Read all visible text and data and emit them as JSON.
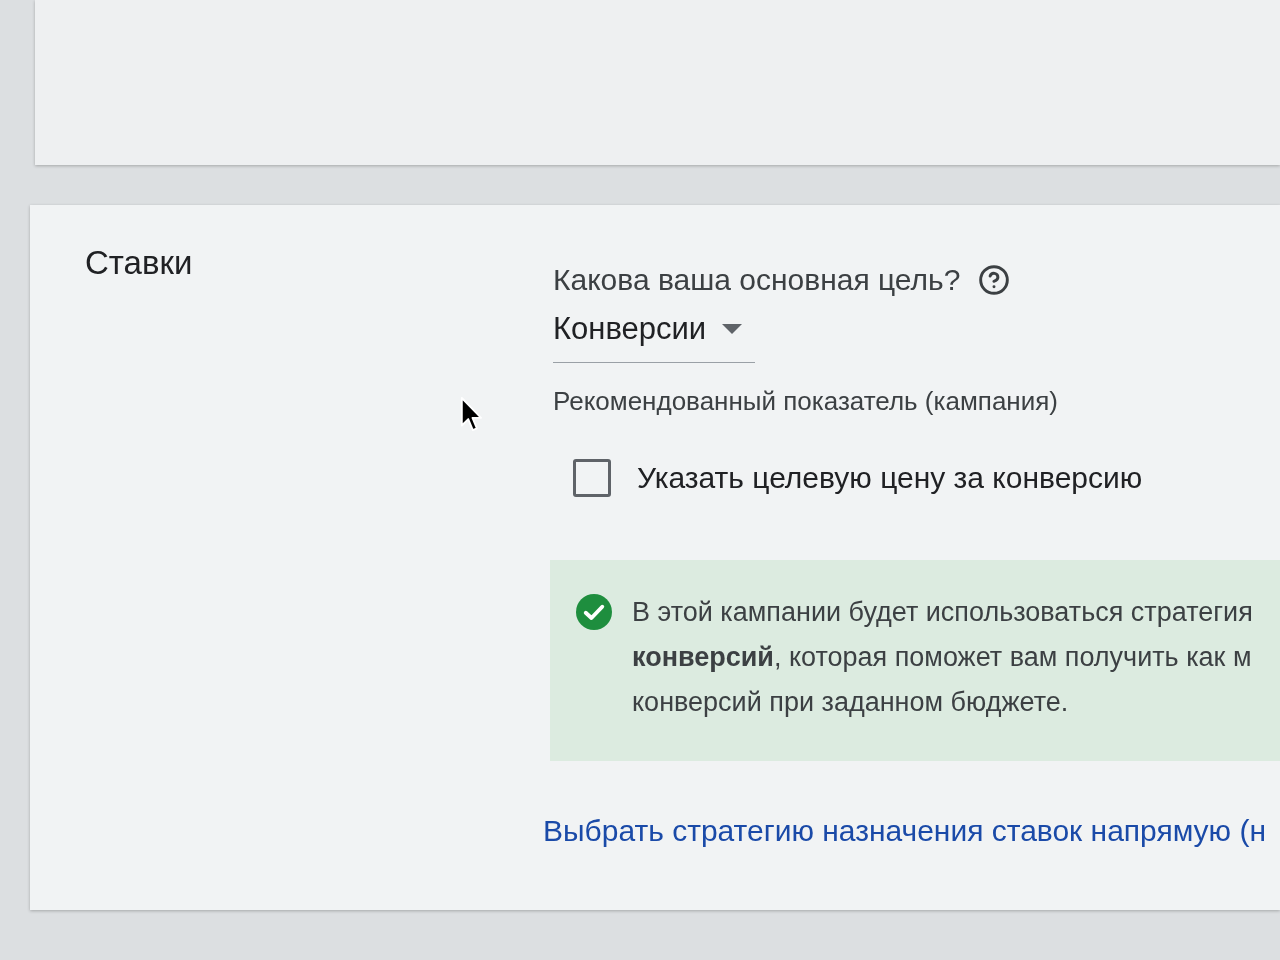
{
  "bidding": {
    "title": "Ставки",
    "goal": {
      "label": "Какова ваша основная цель?",
      "value": "Конверсии"
    },
    "metric_label": "Рекомендованный показатель (кампания)",
    "checkbox": {
      "label": "Указать целевую цену за конверсию",
      "checked": false
    },
    "notice": {
      "lines": [
        "В этой кампании будет использоваться стратегия",
        "**конверсий**, которая поможет вам получить как м",
        "конверсий при заданном бюджете."
      ]
    },
    "link": "Выбрать стратегию назначения ставок напрямую (н"
  }
}
